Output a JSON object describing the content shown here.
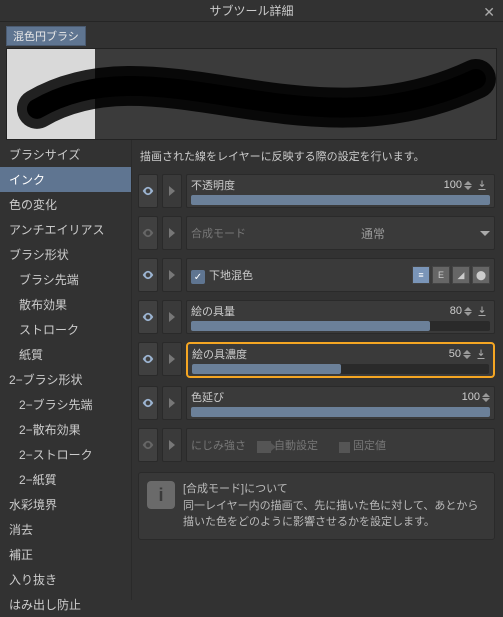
{
  "window": {
    "title": "サブツール詳細"
  },
  "tag": "混色円ブラシ",
  "sidebar": {
    "items": [
      {
        "label": "ブラシサイズ"
      },
      {
        "label": "インク",
        "selected": true
      },
      {
        "label": "色の変化"
      },
      {
        "label": "アンチエイリアス"
      },
      {
        "label": "ブラシ形状"
      },
      {
        "label": "ブラシ先端",
        "sub": true
      },
      {
        "label": "散布効果",
        "sub": true
      },
      {
        "label": "ストローク",
        "sub": true
      },
      {
        "label": "紙質",
        "sub": true
      },
      {
        "label": "2−ブラシ形状"
      },
      {
        "label": "2−ブラシ先端",
        "sub": true
      },
      {
        "label": "2−散布効果",
        "sub": true
      },
      {
        "label": "2−ストローク",
        "sub": true
      },
      {
        "label": "2−紙質",
        "sub": true
      },
      {
        "label": "水彩境界"
      },
      {
        "label": "消去"
      },
      {
        "label": "補正"
      },
      {
        "label": "入り抜き"
      },
      {
        "label": "はみ出し防止"
      }
    ]
  },
  "main": {
    "description": "描画された線をレイヤーに反映する際の設定を行います。",
    "opacity": {
      "label": "不透明度",
      "value": "100",
      "fill": 100
    },
    "blend": {
      "label": "合成モード",
      "value": "通常"
    },
    "mix": {
      "label": "下地混色"
    },
    "paint_amount": {
      "label": "絵の具量",
      "value": "80",
      "fill": 80
    },
    "paint_density": {
      "label": "絵の具濃度",
      "value": "50",
      "fill": 50
    },
    "color_stretch": {
      "label": "色延び",
      "value": "100",
      "fill": 100
    },
    "blur": {
      "label": "にじみ強さ",
      "auto": "自動設定",
      "fixed": "固定値"
    },
    "info": {
      "title": "[合成モード]について",
      "body": "同一レイヤー内の描画で、先に描いた色に対して、あとから描いた色をどのように影響させるかを設定します。"
    }
  }
}
